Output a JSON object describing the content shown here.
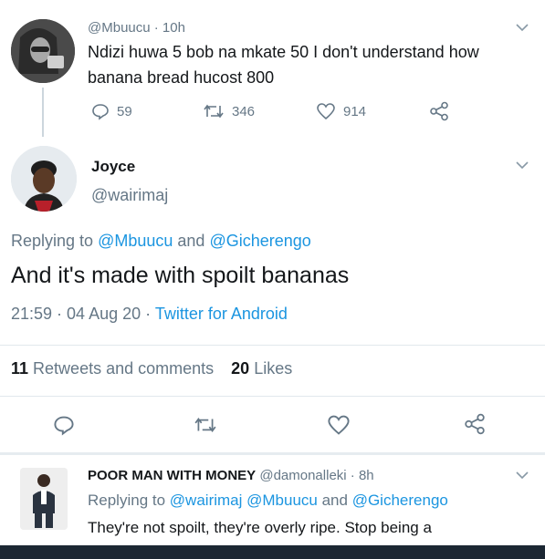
{
  "tweet1": {
    "handle": "@Mbuucu",
    "time": "· 10h",
    "text_line1": "Ndizi huwa 5 bob na mkate 50 I don't understand how",
    "text_line2": "banana bread hucost 800",
    "replies": "59",
    "retweets": "346",
    "likes": "914"
  },
  "tweet2": {
    "name": "Joyce",
    "handle": "@wairimaj",
    "replying_prefix": "Replying to",
    "replying_user1": "@Mbuucu",
    "replying_and": "and",
    "replying_user2": "@Gicherengo",
    "text": "And it's made with spoilt bananas",
    "timestamp": "21:59 · 04 Aug 20 ·",
    "source": "Twitter for Android",
    "retweet_count": "11",
    "retweet_label": "Retweets and comments",
    "like_count": "20",
    "like_label": "Likes"
  },
  "tweet3": {
    "name": "POOR MAN WITH MONEY",
    "handle": "@damonalleki",
    "time": "· 8h",
    "replying_prefix": "Replying to",
    "replying_users": "@wairimaj @Mbuucu",
    "replying_and": "and",
    "replying_user3": "@Gicherengo",
    "text": "They're not spoilt, they're overly ripe. Stop being a"
  },
  "colors": {
    "accent": "#1b95e0",
    "muted": "#657786",
    "text": "#14171a",
    "divider": "#e1e8ed"
  }
}
